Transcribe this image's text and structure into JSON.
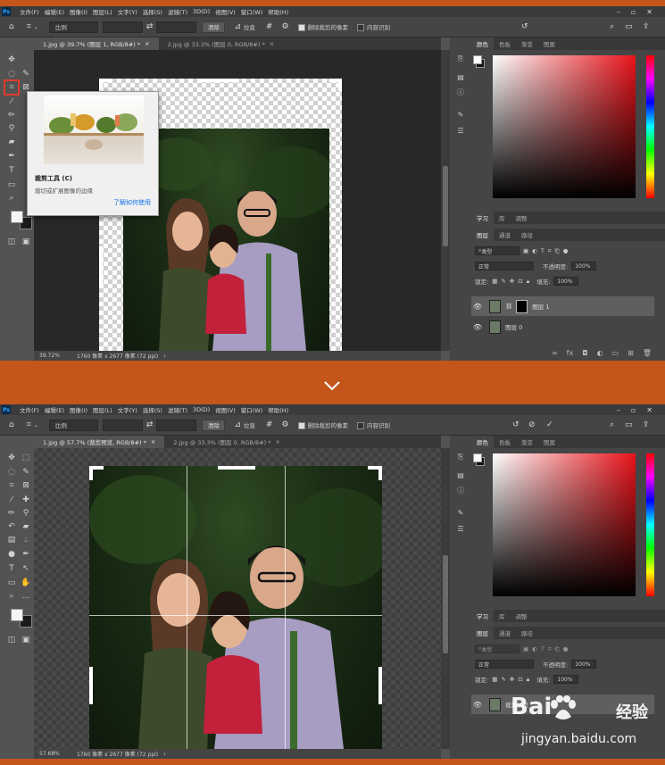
{
  "menus": [
    "文件(F)",
    "编辑(E)",
    "图像(I)",
    "图层(L)",
    "文字(Y)",
    "选择(S)",
    "滤镜(T)",
    "3D(D)",
    "视图(V)",
    "窗口(W)",
    "帮助(H)"
  ],
  "options": {
    "ratio_label": "比例",
    "clear_button": "清除",
    "straighten_label": "拉直",
    "delete_pixels_label": "删除裁剪的像素",
    "content_aware_label": "内容识别"
  },
  "top": {
    "tab_active": "1.jpg @ 39.7% (图层 1, RGB/8#) *",
    "tab_inactive": "2.jpg @ 33.3% (图层 0, RGB/8#) *",
    "zoom": "39.72%",
    "doc_info": "1760 像素 x 2677 像素 (72 ppi)",
    "layers": [
      {
        "name": "图层 1",
        "has_mask": true
      },
      {
        "name": "图层 0",
        "has_mask": false
      }
    ]
  },
  "tooltip": {
    "title": "裁剪工具 (C)",
    "description": "裁切或扩展图像的边缘",
    "link": "了解如何使用"
  },
  "bottom": {
    "tab_active": "1.jpg @ 57.7% (裁剪预览, RGB/8#) *",
    "tab_inactive": "2.jpg @ 33.3% (图层 0, RGB/8#) *",
    "zoom": "57.68%",
    "doc_info": "1760 像素 x 2677 像素 (72 ppi)",
    "layers": [
      {
        "name": "裁剪预览",
        "has_mask": false
      }
    ]
  },
  "panels": {
    "color_tabs": [
      "颜色",
      "色板",
      "渐变",
      "图案"
    ],
    "learn_tabs": [
      "学习",
      "库",
      "调整"
    ],
    "layer_tabs": [
      "图层",
      "通道",
      "路径"
    ],
    "kind_label": "类型",
    "blend_mode": "正常",
    "opacity_label": "不透明度:",
    "opacity_value": "100%",
    "lock_label": "锁定:",
    "fill_label": "填充:",
    "fill_value": "100%"
  },
  "watermark": {
    "brand": "Bai",
    "brand_suffix": "经验",
    "url": "jingyan.baidu.com"
  }
}
